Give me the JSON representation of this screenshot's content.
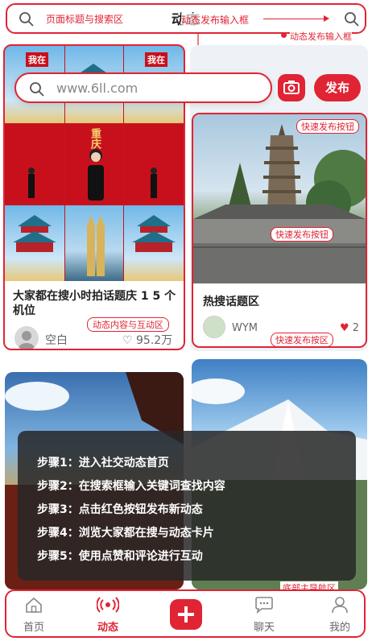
{
  "header": {
    "annotation_left": "页面标题与搜索区",
    "page_title": "动态",
    "annotation_center": "动态发布输入框",
    "annotation_right": "动态发布输入框"
  },
  "search": {
    "placeholder": "www.6ll.com",
    "publish_label": "发布"
  },
  "feed": {
    "card1": {
      "title": "大家都在搜小时拍话题庆 1 5 个机位",
      "user": "空白",
      "likes": "95.2万",
      "annotation": "动态内容与互动区",
      "collage_city": "重庆",
      "sign_text": "我在"
    },
    "card2": {
      "title": "热搜话题区",
      "user": "WYM",
      "likes": "2",
      "annotation_top": "快速发布按钮",
      "annotation_mid": "快速发布按钮",
      "annotation_bottom": "快速发布按区"
    }
  },
  "steps": [
    "步骤1：进入社交动态首页",
    "步骤2：在搜索框输入关键词查找内容",
    "步骤3：点击红色按钮发布新动态",
    "步骤4：浏览大家都在搜与动态卡片",
    "步骤5：使用点赞和评论进行互动"
  ],
  "bottom_nav": {
    "annotation": "底部主导航区",
    "items": [
      {
        "label": "首页",
        "icon": "home-icon"
      },
      {
        "label": "动态",
        "icon": "broadcast-icon"
      },
      {
        "label": "聊天",
        "icon": "chat-icon"
      },
      {
        "label": "我的",
        "icon": "user-icon"
      }
    ]
  },
  "colors": {
    "accent": "#e02434",
    "overlay": "#2a2a2a"
  }
}
